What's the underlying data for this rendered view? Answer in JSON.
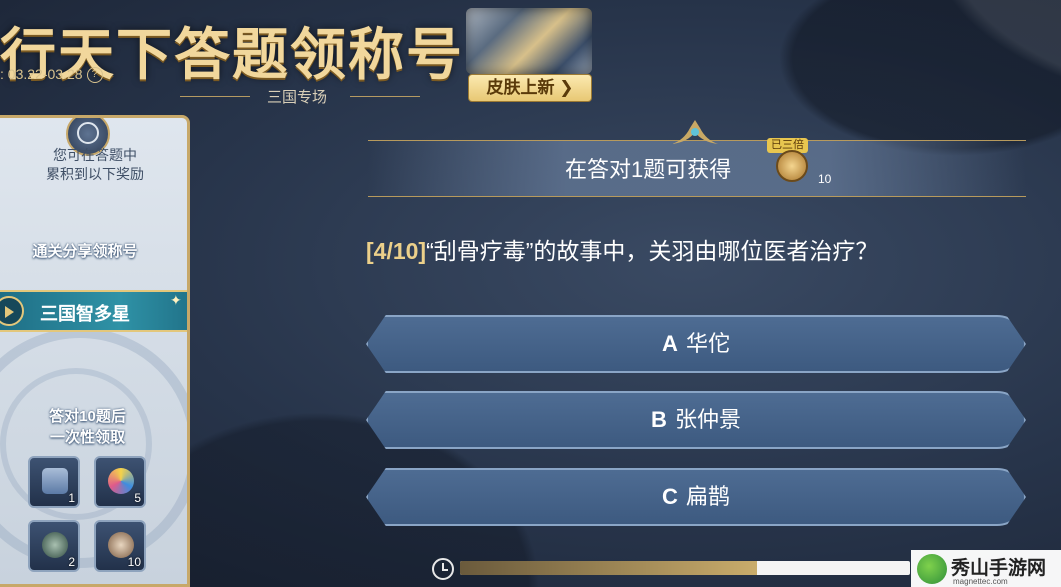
{
  "header": {
    "title": "行天下答题领称号",
    "date": ": 03.22-03.28",
    "subtitle": "三国专场",
    "skin_button": "皮肤上新 ❯"
  },
  "left_panel": {
    "intro_line1": "您可在答题中",
    "intro_line2": "累积到以下奖励",
    "share_label": "通关分享领称号",
    "title_name": "三国智多星",
    "reward_line1": "答对10题后",
    "reward_line2": "一次性领取",
    "rewards": [
      {
        "icon": "chest-icon",
        "count": "1"
      },
      {
        "icon": "badge-5-icon",
        "count": "5"
      },
      {
        "icon": "gem-icon",
        "count": "2"
      },
      {
        "icon": "lock-bag-icon",
        "count": "10"
      }
    ]
  },
  "reward_bar": {
    "text": "在答对1题可获得",
    "double_badge": "已三倍",
    "count": "10"
  },
  "question": {
    "number": "[4/10]",
    "text": "“刮骨疗毒”的故事中，关羽由哪位医者治疗？"
  },
  "options": [
    {
      "letter": "A",
      "text": "华佗"
    },
    {
      "letter": "B",
      "text": "张仲景"
    },
    {
      "letter": "C",
      "text": "扁鹊"
    }
  ],
  "timer": {
    "progress": 0.66
  },
  "watermark": {
    "name": "秀山手游网",
    "url": "magnettec.com"
  },
  "colors": {
    "gold": "#f1d79c",
    "option_blue": "#4e6c93",
    "banner_teal": "#2f92a6"
  }
}
